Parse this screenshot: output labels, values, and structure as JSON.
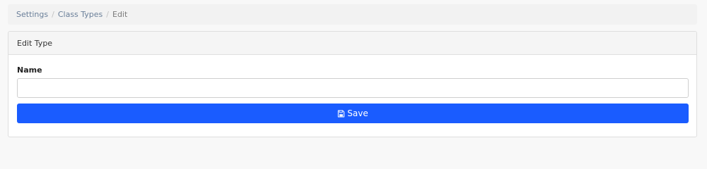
{
  "breadcrumb": {
    "items": [
      "Settings",
      "Class Types",
      "Edit"
    ],
    "separator": "/"
  },
  "card": {
    "title": "Edit Type"
  },
  "form": {
    "name_label": "Name",
    "name_value": "",
    "name_placeholder": ""
  },
  "actions": {
    "save_label": "Save",
    "save_icon": "floppy-disk-icon"
  },
  "colors": {
    "primary": "#1a5cff",
    "breadcrumb_link": "#6a7f99",
    "page_background": "#f8f8f8"
  }
}
